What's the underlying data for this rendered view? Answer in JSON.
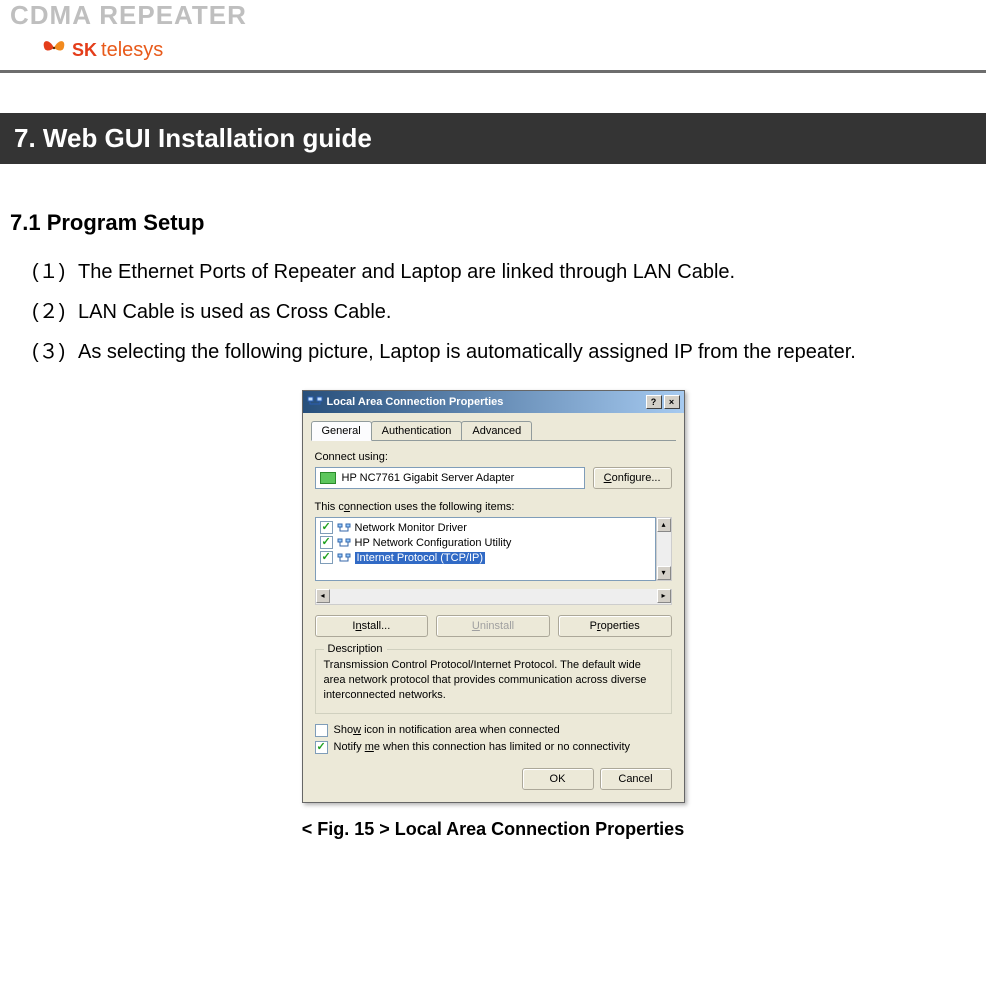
{
  "header": {
    "title": "CDMA REPEATER",
    "brand_text": "telesys"
  },
  "section": {
    "number_title": "7. Web GUI Installation guide"
  },
  "subsection": {
    "heading": "7.1  Program Setup",
    "items": [
      {
        "num": "(１)",
        "text": "The Ethernet Ports of Repeater and Laptop are linked through LAN Cable."
      },
      {
        "num": "(２)",
        "text": "LAN Cable is used as Cross Cable."
      },
      {
        "num": "(３)",
        "text": "As selecting the following picture, Laptop is automatically assigned IP from the repeater."
      }
    ]
  },
  "dialog": {
    "title": "Local Area Connection Properties",
    "help_btn": "?",
    "close_btn": "×",
    "tabs": [
      {
        "label": "General",
        "active": true
      },
      {
        "label": "Authentication",
        "active": false
      },
      {
        "label": "Advanced",
        "active": false
      }
    ],
    "connect_using_label": "Connect using:",
    "adapter_name": "HP NC7761 Gigabit Server Adapter",
    "configure_btn_label": "Configure...",
    "items_label": "This connection uses the following items:",
    "items": [
      {
        "checked": true,
        "label": "Network Monitor Driver",
        "selected": false
      },
      {
        "checked": true,
        "label": "HP Network Configuration Utility",
        "selected": false
      },
      {
        "checked": true,
        "label": "Internet Protocol (TCP/IP)",
        "selected": true
      }
    ],
    "install_btn": "Install...",
    "uninstall_btn": "Uninstall",
    "properties_btn": "Properties",
    "description_legend": "Description",
    "description_text": "Transmission Control Protocol/Internet Protocol. The default wide area network protocol that provides communication across diverse interconnected networks.",
    "show_icon_label": "Show icon in notification area when connected",
    "notify_label": "Notify me when this connection has limited or no connectivity",
    "show_icon_checked": false,
    "notify_checked": true,
    "ok_btn": "OK",
    "cancel_btn": "Cancel"
  },
  "figure": {
    "caption": "< Fig. 15 > Local Area Connection Properties"
  }
}
